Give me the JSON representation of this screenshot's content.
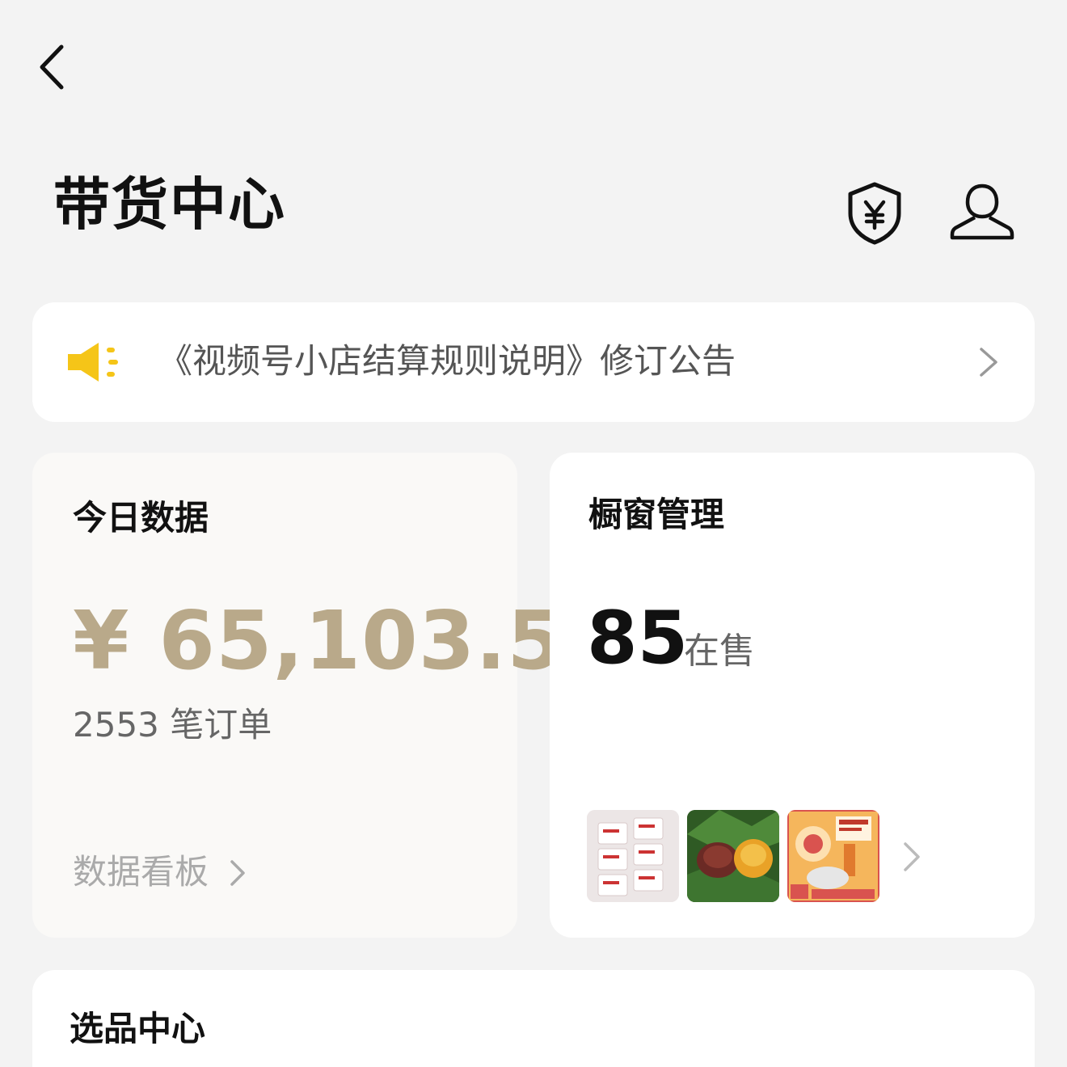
{
  "header": {
    "title": "带货中心",
    "back_icon": "chevron-left-icon",
    "shield_icon": "shield-yen-icon",
    "user_icon": "user-icon"
  },
  "notice": {
    "icon": "megaphone-icon",
    "text": "《视频号小店结算规则说明》修订公告"
  },
  "today": {
    "title": "今日数据",
    "amount": "¥ 65,103.5",
    "orders": "2553 笔订单",
    "link": "数据看板"
  },
  "window": {
    "title": "橱窗管理",
    "count": "85",
    "count_label": "在售"
  },
  "pick_center": {
    "title": "选品中心"
  },
  "colors": {
    "background": "#f3f3f3",
    "amount": "#b9a98a",
    "megaphone": "#f5c518"
  }
}
